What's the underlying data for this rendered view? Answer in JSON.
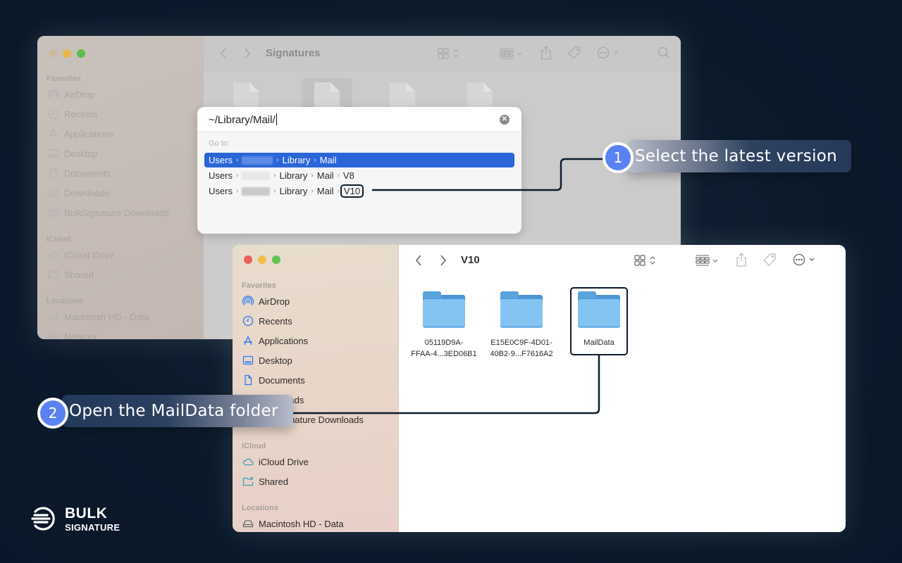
{
  "back_window": {
    "title": "Signatures",
    "sidebar": {
      "sections": [
        {
          "label": "Favorites",
          "items": [
            {
              "label": "AirDrop",
              "icon": "airdrop-icon"
            },
            {
              "label": "Recents",
              "icon": "clock-icon"
            },
            {
              "label": "Applications",
              "icon": "applications-icon"
            },
            {
              "label": "Desktop",
              "icon": "desktop-icon"
            },
            {
              "label": "Documents",
              "icon": "document-icon"
            },
            {
              "label": "Downloads",
              "icon": "download-icon"
            },
            {
              "label": "BulkSignature Downloads",
              "icon": "folder-icon"
            }
          ]
        },
        {
          "label": "iCloud",
          "items": [
            {
              "label": "iCloud Drive",
              "icon": "cloud-icon"
            },
            {
              "label": "Shared",
              "icon": "shared-folder-icon"
            }
          ]
        },
        {
          "label": "Locations",
          "items": [
            {
              "label": "Macintosh HD - Data",
              "icon": "disk-icon"
            },
            {
              "label": "Network",
              "icon": "network-icon"
            }
          ]
        }
      ]
    }
  },
  "goto_dialog": {
    "input_value": "~/Library/Mail/",
    "section_label": "Go to:",
    "suggestions": [
      {
        "segments": [
          "Users",
          "",
          "Library",
          "Mail"
        ],
        "selected": true
      },
      {
        "segments": [
          "Users",
          "",
          "Library",
          "Mail",
          "V8"
        ],
        "selected": false
      },
      {
        "segments": [
          "Users",
          "",
          "Library",
          "Mail",
          "V10"
        ],
        "selected": false
      }
    ]
  },
  "front_window": {
    "title": "V10",
    "sidebar": {
      "sections": [
        {
          "label": "Favorites",
          "items": [
            {
              "label": "AirDrop",
              "icon": "airdrop-icon"
            },
            {
              "label": "Recents",
              "icon": "clock-icon"
            },
            {
              "label": "Applications",
              "icon": "applications-icon"
            },
            {
              "label": "Desktop",
              "icon": "desktop-icon"
            },
            {
              "label": "Documents",
              "icon": "document-icon"
            },
            {
              "label": "Downloads",
              "icon": "download-icon"
            },
            {
              "label": "BulkSignature Downloads",
              "icon": "folder-icon"
            }
          ]
        },
        {
          "label": "iCloud",
          "items": [
            {
              "label": "iCloud Drive",
              "icon": "cloud-icon"
            },
            {
              "label": "Shared",
              "icon": "shared-folder-icon"
            }
          ]
        },
        {
          "label": "Locations",
          "items": [
            {
              "label": "Macintosh HD - Data",
              "icon": "disk-icon"
            }
          ]
        }
      ]
    },
    "folders": [
      {
        "name_line1": "05119D9A-",
        "name_line2": "FFAA-4...3ED06B1"
      },
      {
        "name_line1": "E15E0C9F-4D01-",
        "name_line2": "40B2-9...F7616A2"
      },
      {
        "name_line1": "MailData",
        "name_line2": "",
        "highlighted": true
      }
    ]
  },
  "callouts": [
    {
      "number": "1",
      "text": "Select the latest version"
    },
    {
      "number": "2",
      "text": "Open the MailData folder"
    }
  ],
  "brand": {
    "line1": "BULK",
    "line2": "SIGNATURE"
  },
  "colors": {
    "background": "#0b1a2b",
    "badge": "#5b82f2",
    "selection": "#2a66d8",
    "connector": "#0d1d2e",
    "folder": "#84c4f3",
    "sidebar_icon": "#2f7bf0"
  }
}
